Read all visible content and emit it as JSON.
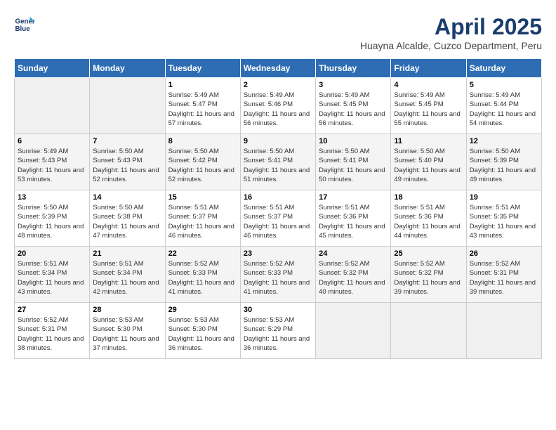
{
  "header": {
    "logo_line1": "General",
    "logo_line2": "Blue",
    "month_year": "April 2025",
    "location": "Huayna Alcalde, Cuzco Department, Peru"
  },
  "days_of_week": [
    "Sunday",
    "Monday",
    "Tuesday",
    "Wednesday",
    "Thursday",
    "Friday",
    "Saturday"
  ],
  "weeks": [
    [
      {
        "day": "",
        "sunrise": "",
        "sunset": "",
        "daylight": ""
      },
      {
        "day": "",
        "sunrise": "",
        "sunset": "",
        "daylight": ""
      },
      {
        "day": "1",
        "sunrise": "Sunrise: 5:49 AM",
        "sunset": "Sunset: 5:47 PM",
        "daylight": "Daylight: 11 hours and 57 minutes."
      },
      {
        "day": "2",
        "sunrise": "Sunrise: 5:49 AM",
        "sunset": "Sunset: 5:46 PM",
        "daylight": "Daylight: 11 hours and 56 minutes."
      },
      {
        "day": "3",
        "sunrise": "Sunrise: 5:49 AM",
        "sunset": "Sunset: 5:45 PM",
        "daylight": "Daylight: 11 hours and 56 minutes."
      },
      {
        "day": "4",
        "sunrise": "Sunrise: 5:49 AM",
        "sunset": "Sunset: 5:45 PM",
        "daylight": "Daylight: 11 hours and 55 minutes."
      },
      {
        "day": "5",
        "sunrise": "Sunrise: 5:49 AM",
        "sunset": "Sunset: 5:44 PM",
        "daylight": "Daylight: 11 hours and 54 minutes."
      }
    ],
    [
      {
        "day": "6",
        "sunrise": "Sunrise: 5:49 AM",
        "sunset": "Sunset: 5:43 PM",
        "daylight": "Daylight: 11 hours and 53 minutes."
      },
      {
        "day": "7",
        "sunrise": "Sunrise: 5:50 AM",
        "sunset": "Sunset: 5:43 PM",
        "daylight": "Daylight: 11 hours and 52 minutes."
      },
      {
        "day": "8",
        "sunrise": "Sunrise: 5:50 AM",
        "sunset": "Sunset: 5:42 PM",
        "daylight": "Daylight: 11 hours and 52 minutes."
      },
      {
        "day": "9",
        "sunrise": "Sunrise: 5:50 AM",
        "sunset": "Sunset: 5:41 PM",
        "daylight": "Daylight: 11 hours and 51 minutes."
      },
      {
        "day": "10",
        "sunrise": "Sunrise: 5:50 AM",
        "sunset": "Sunset: 5:41 PM",
        "daylight": "Daylight: 11 hours and 50 minutes."
      },
      {
        "day": "11",
        "sunrise": "Sunrise: 5:50 AM",
        "sunset": "Sunset: 5:40 PM",
        "daylight": "Daylight: 11 hours and 49 minutes."
      },
      {
        "day": "12",
        "sunrise": "Sunrise: 5:50 AM",
        "sunset": "Sunset: 5:39 PM",
        "daylight": "Daylight: 11 hours and 49 minutes."
      }
    ],
    [
      {
        "day": "13",
        "sunrise": "Sunrise: 5:50 AM",
        "sunset": "Sunset: 5:39 PM",
        "daylight": "Daylight: 11 hours and 48 minutes."
      },
      {
        "day": "14",
        "sunrise": "Sunrise: 5:50 AM",
        "sunset": "Sunset: 5:38 PM",
        "daylight": "Daylight: 11 hours and 47 minutes."
      },
      {
        "day": "15",
        "sunrise": "Sunrise: 5:51 AM",
        "sunset": "Sunset: 5:37 PM",
        "daylight": "Daylight: 11 hours and 46 minutes."
      },
      {
        "day": "16",
        "sunrise": "Sunrise: 5:51 AM",
        "sunset": "Sunset: 5:37 PM",
        "daylight": "Daylight: 11 hours and 46 minutes."
      },
      {
        "day": "17",
        "sunrise": "Sunrise: 5:51 AM",
        "sunset": "Sunset: 5:36 PM",
        "daylight": "Daylight: 11 hours and 45 minutes."
      },
      {
        "day": "18",
        "sunrise": "Sunrise: 5:51 AM",
        "sunset": "Sunset: 5:36 PM",
        "daylight": "Daylight: 11 hours and 44 minutes."
      },
      {
        "day": "19",
        "sunrise": "Sunrise: 5:51 AM",
        "sunset": "Sunset: 5:35 PM",
        "daylight": "Daylight: 11 hours and 43 minutes."
      }
    ],
    [
      {
        "day": "20",
        "sunrise": "Sunrise: 5:51 AM",
        "sunset": "Sunset: 5:34 PM",
        "daylight": "Daylight: 11 hours and 43 minutes."
      },
      {
        "day": "21",
        "sunrise": "Sunrise: 5:51 AM",
        "sunset": "Sunset: 5:34 PM",
        "daylight": "Daylight: 11 hours and 42 minutes."
      },
      {
        "day": "22",
        "sunrise": "Sunrise: 5:52 AM",
        "sunset": "Sunset: 5:33 PM",
        "daylight": "Daylight: 11 hours and 41 minutes."
      },
      {
        "day": "23",
        "sunrise": "Sunrise: 5:52 AM",
        "sunset": "Sunset: 5:33 PM",
        "daylight": "Daylight: 11 hours and 41 minutes."
      },
      {
        "day": "24",
        "sunrise": "Sunrise: 5:52 AM",
        "sunset": "Sunset: 5:32 PM",
        "daylight": "Daylight: 11 hours and 40 minutes."
      },
      {
        "day": "25",
        "sunrise": "Sunrise: 5:52 AM",
        "sunset": "Sunset: 5:32 PM",
        "daylight": "Daylight: 11 hours and 39 minutes."
      },
      {
        "day": "26",
        "sunrise": "Sunrise: 5:52 AM",
        "sunset": "Sunset: 5:31 PM",
        "daylight": "Daylight: 11 hours and 39 minutes."
      }
    ],
    [
      {
        "day": "27",
        "sunrise": "Sunrise: 5:52 AM",
        "sunset": "Sunset: 5:31 PM",
        "daylight": "Daylight: 11 hours and 38 minutes."
      },
      {
        "day": "28",
        "sunrise": "Sunrise: 5:53 AM",
        "sunset": "Sunset: 5:30 PM",
        "daylight": "Daylight: 11 hours and 37 minutes."
      },
      {
        "day": "29",
        "sunrise": "Sunrise: 5:53 AM",
        "sunset": "Sunset: 5:30 PM",
        "daylight": "Daylight: 11 hours and 36 minutes."
      },
      {
        "day": "30",
        "sunrise": "Sunrise: 5:53 AM",
        "sunset": "Sunset: 5:29 PM",
        "daylight": "Daylight: 11 hours and 36 minutes."
      },
      {
        "day": "",
        "sunrise": "",
        "sunset": "",
        "daylight": ""
      },
      {
        "day": "",
        "sunrise": "",
        "sunset": "",
        "daylight": ""
      },
      {
        "day": "",
        "sunrise": "",
        "sunset": "",
        "daylight": ""
      }
    ]
  ]
}
